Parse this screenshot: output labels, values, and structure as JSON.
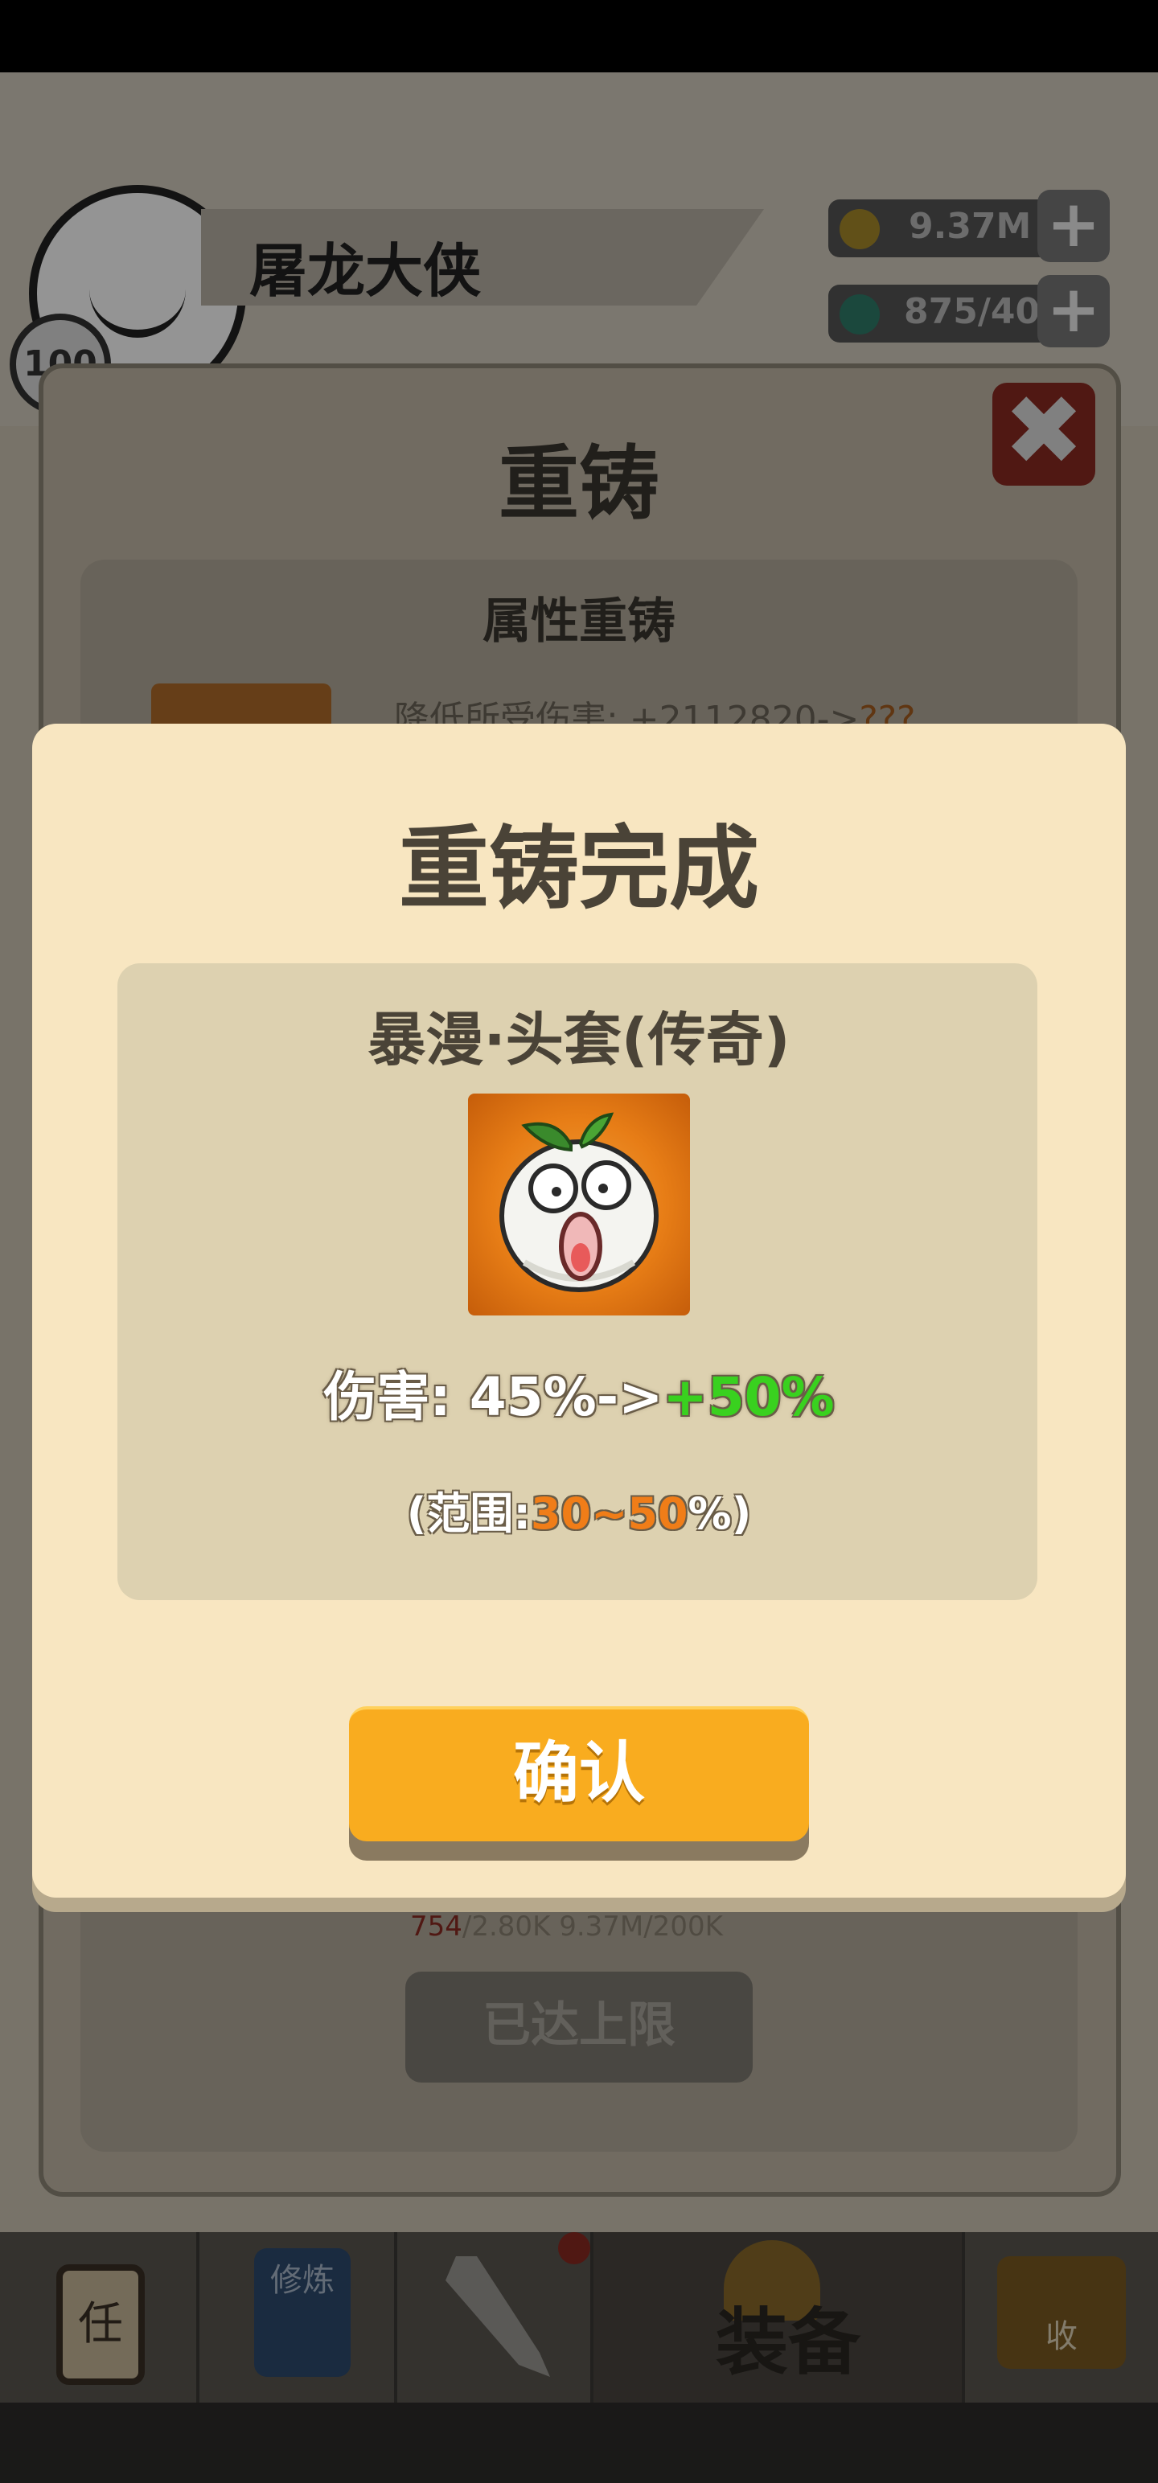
{
  "hud": {
    "player_name": "屠龙大侠",
    "level": "100",
    "gold": "9.37M",
    "gems": "875/40",
    "add_label": "+"
  },
  "background_panel": {
    "title": "重铸",
    "close_label": "✖",
    "subtitle": "属性重铸",
    "stat_prefix": "降低所受伤害: +2112820->",
    "stat_value": "???",
    "cost_left": "754",
    "cost_left_rest": "/2.80K",
    "cost_right": "9.37M/200K",
    "maxed_button": "已达上限"
  },
  "bottom_nav": {
    "items": [
      {
        "icon": "scroll-task-icon",
        "glyph": "任"
      },
      {
        "icon": "book-cultivate-icon",
        "glyph": "修炼"
      },
      {
        "icon": "crossed-swords-icon"
      },
      {
        "icon": "helmet-equip-icon",
        "label": "装备"
      },
      {
        "icon": "chest-collect-icon",
        "glyph": "收"
      }
    ]
  },
  "modal": {
    "title": "重铸完成",
    "item_name": "暴漫·头套(传奇)",
    "item_icon": "screaming-radish-icon",
    "stat_label": "伤害:",
    "stat_old": "45%->",
    "stat_new": "+50%",
    "range_prefix": "(范围:",
    "range_values": "30~50",
    "range_suffix": "%)",
    "confirm_label": "确认"
  },
  "colors": {
    "modal_bg": "#f8e6c1",
    "panel_bg": "#ddd1b0",
    "confirm_bg": "#f9ac1f",
    "new_value": "#39d11f",
    "range_value": "#f07d18"
  }
}
